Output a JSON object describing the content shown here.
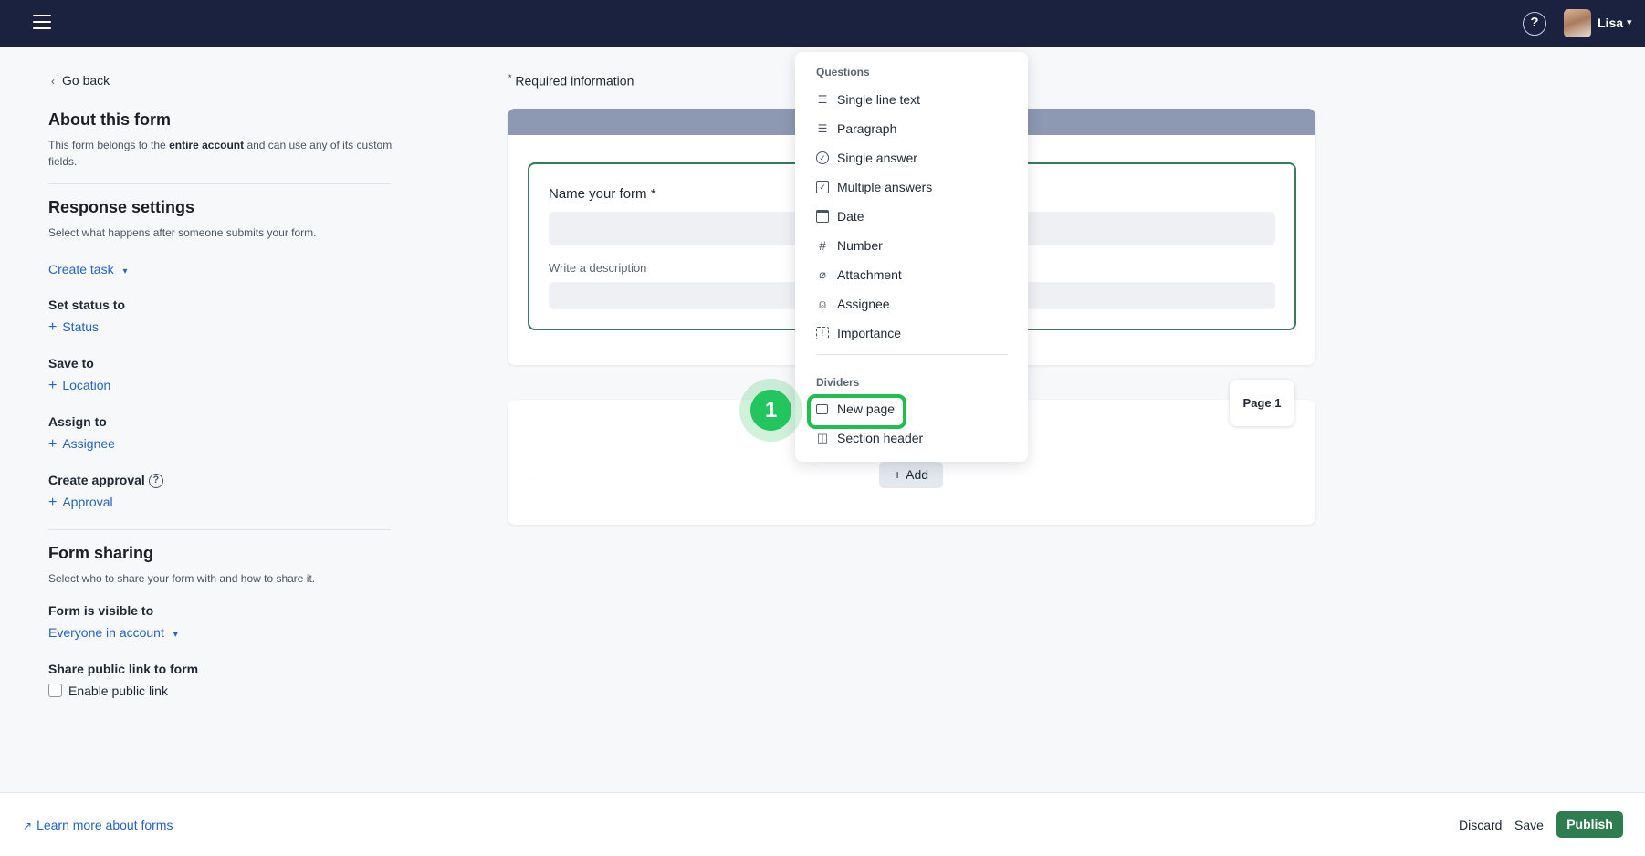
{
  "header": {
    "user_name": "Lisa",
    "help_symbol": "?",
    "caret": "⌄"
  },
  "sidebar": {
    "back_label": "Go back",
    "about": {
      "title": "About this form",
      "desc_pre": "This form belongs to the ",
      "desc_bold": "entire account",
      "desc_post": " and can use any of its custom fields."
    },
    "response": {
      "title": "Response settings",
      "desc": "Select what happens after someone submits your form.",
      "create_task": "Create task",
      "status_label": "Set status to",
      "status_link": "Status",
      "save_label": "Save to",
      "save_link": "Location",
      "assign_label": "Assign to",
      "assign_link": "Assignee",
      "approval_label": "Create approval",
      "approval_link": "Approval"
    },
    "sharing": {
      "title": "Form sharing",
      "desc": "Select who to share your form with and how to share it.",
      "visible_label": "Form is visible to",
      "visible_value": "Everyone in account",
      "public_label": "Share public link to form",
      "public_checkbox": "Enable public link"
    }
  },
  "main": {
    "required_star": "*",
    "required_text": " Required information",
    "name_label": "Name your form *",
    "desc_label": "Write a description",
    "page_badge": "Page 1",
    "add_label": "Add"
  },
  "dropdown": {
    "questions_title": "Questions",
    "questions": [
      {
        "label": "Single line text",
        "icon": "text-lines-icon"
      },
      {
        "label": "Paragraph",
        "icon": "paragraph-icon"
      },
      {
        "label": "Single answer",
        "icon": "check-circle-icon"
      },
      {
        "label": "Multiple answers",
        "icon": "checkbox-icon"
      },
      {
        "label": "Date",
        "icon": "calendar-icon"
      },
      {
        "label": "Number",
        "icon": "hash-icon"
      },
      {
        "label": "Attachment",
        "icon": "paperclip-icon"
      },
      {
        "label": "Assignee",
        "icon": "person-icon"
      },
      {
        "label": "Importance",
        "icon": "importance-icon"
      }
    ],
    "dividers_title": "Dividers",
    "dividers": [
      {
        "label": "New page",
        "icon": "pages-icon"
      },
      {
        "label": "Section header",
        "icon": "book-icon"
      }
    ]
  },
  "annotation": {
    "step_number": "1",
    "highlight_color": "#1fbf4f"
  },
  "footer": {
    "learn_link": "Learn more about forms",
    "discard": "Discard",
    "save": "Save",
    "publish": "Publish"
  },
  "colors": {
    "topbar": "#1b2240",
    "link": "#2563c9",
    "publish": "#2e7d4f",
    "card_header": "#8d98b2",
    "name_border": "#3a7a5c"
  }
}
